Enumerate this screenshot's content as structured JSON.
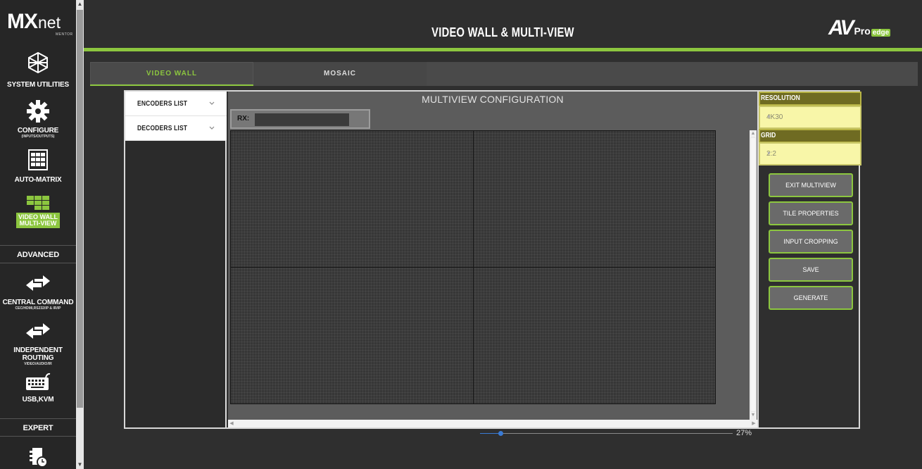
{
  "sidebar": {
    "logo": {
      "mx": "MX",
      "net": "net",
      "mentor": "MENTOR"
    },
    "items": [
      {
        "label": "SYSTEM UTILITIES",
        "sub": "",
        "icon": "network-globe-icon"
      },
      {
        "label": "CONFIGURE",
        "sub": "(INPUTS/OUTPUTS)",
        "icon": "gear-icon"
      },
      {
        "label": "AUTO-MATRIX",
        "sub": "",
        "icon": "matrix-grid-icon"
      },
      {
        "label": "VIDEO WALL\nMULTI-VIEW",
        "label1": "VIDEO WALL",
        "label2": "MULTI-VIEW",
        "sub": "",
        "icon": "video-wall-icon"
      }
    ],
    "section_advanced": "ADVANCED",
    "advanced_items": [
      {
        "label": "CENTRAL COMMAND",
        "sub": "CEC/HDMI,RS232/IP & IR/IP",
        "icon": "arrows-icon"
      },
      {
        "label": "INDEPENDENT ROUTING",
        "sub": "VIDEO/AUDIO/IR",
        "icon": "arrows-icon"
      },
      {
        "label": "USB,KVM",
        "sub": "",
        "icon": "keyboard-icon"
      }
    ],
    "section_expert": "EXPERT",
    "active_color": "#8cc63f"
  },
  "header": {
    "title": "VIDEO WALL & MULTI-VIEW",
    "brand_av": "AV",
    "brand_pro": "Pro",
    "brand_edge": "edge"
  },
  "tabs": [
    {
      "label": "VIDEO WALL",
      "active": true
    },
    {
      "label": "MOSAIC",
      "active": false
    }
  ],
  "lists": {
    "encoders": "ENCODERS LIST",
    "decoders": "DECODERS LIST"
  },
  "canvas": {
    "title": "MULTIVIEW CONFIGURATION",
    "rx_label": "RX:",
    "rx_value": ""
  },
  "controls": {
    "resolution_label": "RESOLUTION",
    "resolution_value": "4K30",
    "grid_label": "GRID",
    "grid_value": "2:2",
    "buttons": {
      "exit_multiview": "EXIT MULTIVIEW",
      "tile_properties": "TILE PROPERTIES",
      "input_cropping": "INPUT CROPPING",
      "save": "SAVE",
      "generate": "GENERATE"
    }
  },
  "zoom": {
    "percent": "27%",
    "value": 0.27
  },
  "colors": {
    "accent": "#8cc63f",
    "field_yellow": "#f8f6a8",
    "header_olive": "#6f6b22"
  }
}
